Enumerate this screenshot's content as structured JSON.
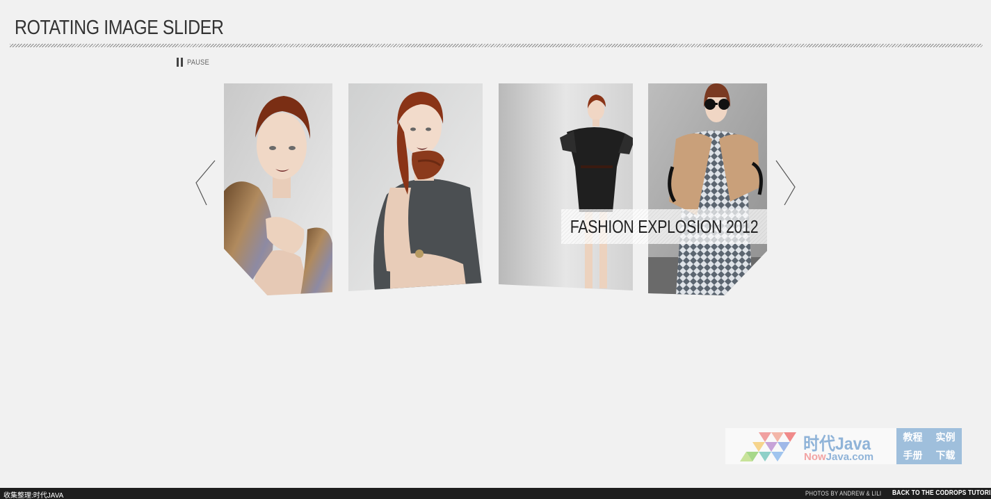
{
  "header": {
    "title": "ROTATING IMAGE SLIDER"
  },
  "controls": {
    "pause_label": "PAUSE"
  },
  "slider": {
    "caption": "FASHION EXPLOSION 2012",
    "slides": [
      {
        "name": "model-fur-stole"
      },
      {
        "name": "model-knit-scarf"
      },
      {
        "name": "model-black-dress"
      },
      {
        "name": "model-print-dress"
      }
    ]
  },
  "watermark": {
    "name": "时代Java",
    "domain_prefix": "Now",
    "domain_rest": "Java.com",
    "tags": [
      "教程",
      "实例",
      "手册",
      "下载"
    ]
  },
  "footer": {
    "left": "收集整理:时代JAVA",
    "credit": "PHOTOS BY ANDREW & LILI",
    "link": "BACK TO THE CODROPS TUTORIAL"
  },
  "icons": {
    "pause": "pause-icon",
    "prev": "chevron-left-icon",
    "next": "chevron-right-icon"
  }
}
